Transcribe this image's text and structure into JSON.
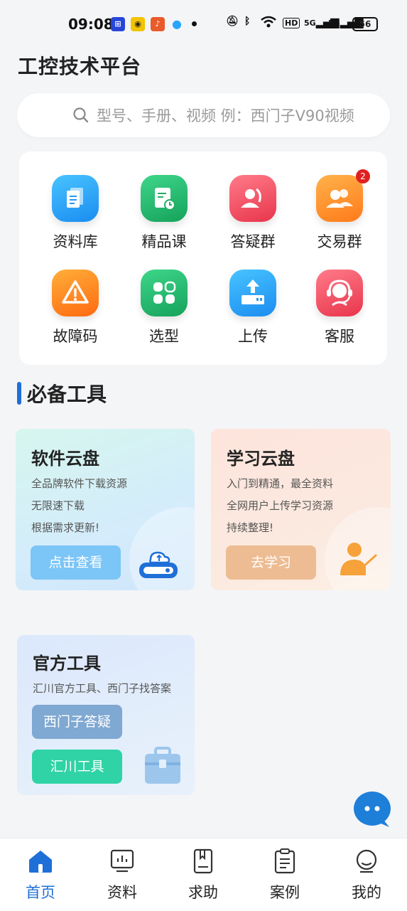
{
  "status": {
    "time": "09:08",
    "hd": "HD",
    "net1": "5G",
    "net2": "5G",
    "battery": "56"
  },
  "header": {
    "title": "工控技术平台"
  },
  "search": {
    "placeholder": "型号、手册、视频 例：西门子V90视频"
  },
  "grid": {
    "items": [
      {
        "label": "资料库",
        "icon": "document-stack-icon"
      },
      {
        "label": "精品课",
        "icon": "course-icon"
      },
      {
        "label": "答疑群",
        "icon": "qa-group-icon"
      },
      {
        "label": "交易群",
        "icon": "trade-group-icon",
        "badge": "2"
      },
      {
        "label": "故障码",
        "icon": "warning-icon"
      },
      {
        "label": "选型",
        "icon": "selection-icon"
      },
      {
        "label": "上传",
        "icon": "upload-icon"
      },
      {
        "label": "客服",
        "icon": "customer-service-icon"
      }
    ]
  },
  "section": {
    "title": "必备工具"
  },
  "cards": {
    "software": {
      "title": "软件云盘",
      "lines": [
        "全品牌软件下载资源",
        "无限速下载",
        "根据需求更新!"
      ],
      "button": "点击查看"
    },
    "learning": {
      "title": "学习云盘",
      "lines": [
        "入门到精通，最全资料",
        "全网用户上传学习资源",
        "持续整理!"
      ],
      "button": "去学习"
    },
    "official": {
      "title": "官方工具",
      "desc": "汇川官方工具、西门子找答案",
      "button1": "西门子答疑",
      "button2": "汇川工具"
    }
  },
  "nav": {
    "items": [
      {
        "label": "首页",
        "icon": "home-icon",
        "active": true
      },
      {
        "label": "资料",
        "icon": "materials-icon"
      },
      {
        "label": "求助",
        "icon": "help-book-icon"
      },
      {
        "label": "案例",
        "icon": "clipboard-icon"
      },
      {
        "label": "我的",
        "icon": "profile-icon"
      }
    ]
  },
  "colors": {
    "accent": "#1f6fd8",
    "softBtn": "#7cc5f7",
    "learnBtn": "#edbc92",
    "siemensBtn": "#7fa8d2",
    "huichuanBtn": "#2fd3a5"
  }
}
